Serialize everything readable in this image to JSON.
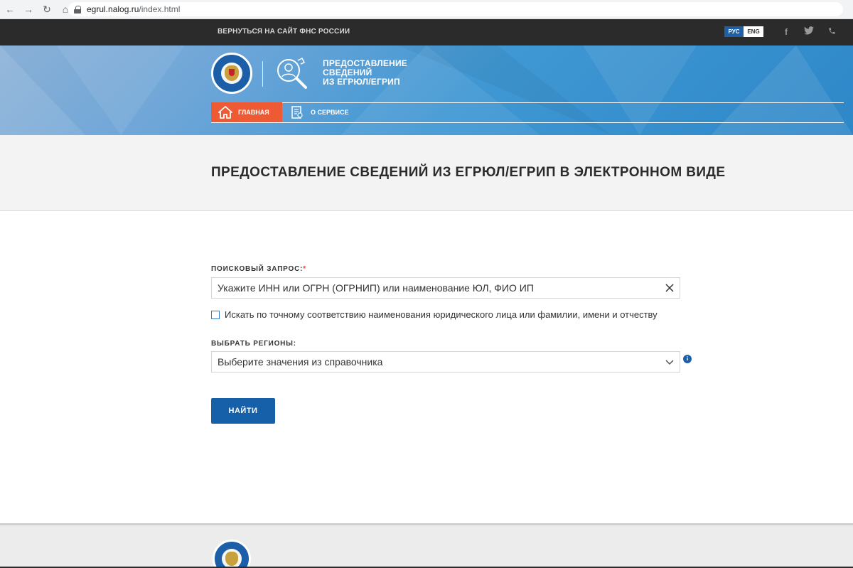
{
  "browser": {
    "url_host": "egrul.nalog.ru",
    "url_path": "/index.html"
  },
  "topbar": {
    "back_link": "ВЕРНУТЬСЯ НА САЙТ ФНС РОССИИ",
    "lang_ru": "РУС",
    "lang_en": "ENG",
    "social_icons": [
      "facebook-icon",
      "twitter-icon",
      "phone-icon"
    ]
  },
  "header": {
    "service_title_lines": [
      "ПРЕДОСТАВЛЕНИЕ",
      "СВЕДЕНИЙ",
      "ИЗ ЕГРЮЛ/ЕГРИП"
    ],
    "nav": {
      "main": "ГЛАВНАЯ",
      "about": "О СЕРВИСЕ"
    },
    "colors": {
      "accent": "#ee5a34",
      "brand": "#1f5fa8"
    }
  },
  "page": {
    "title": "ПРЕДОСТАВЛЕНИЕ СВЕДЕНИЙ ИЗ ЕГРЮЛ/ЕГРИП В ЭЛЕКТРОННОМ ВИДЕ"
  },
  "form": {
    "query_label": "ПОИСКОВЫЙ ЗАПРОС:",
    "query_required_mark": "*",
    "query_placeholder": "Укажите ИНН или ОГРН (ОГРНИП) или наименование ЮЛ, ФИО ИП",
    "exact_match_label": "Искать по точному соответствию наименования юридического лица или фамилии, имени и отчеству",
    "exact_match_checked": false,
    "regions_label": "ВЫБРАТЬ РЕГИОНЫ:",
    "regions_placeholder": "Выберите значения из справочника",
    "info_glyph": "i",
    "submit_label": "НАЙТИ"
  }
}
